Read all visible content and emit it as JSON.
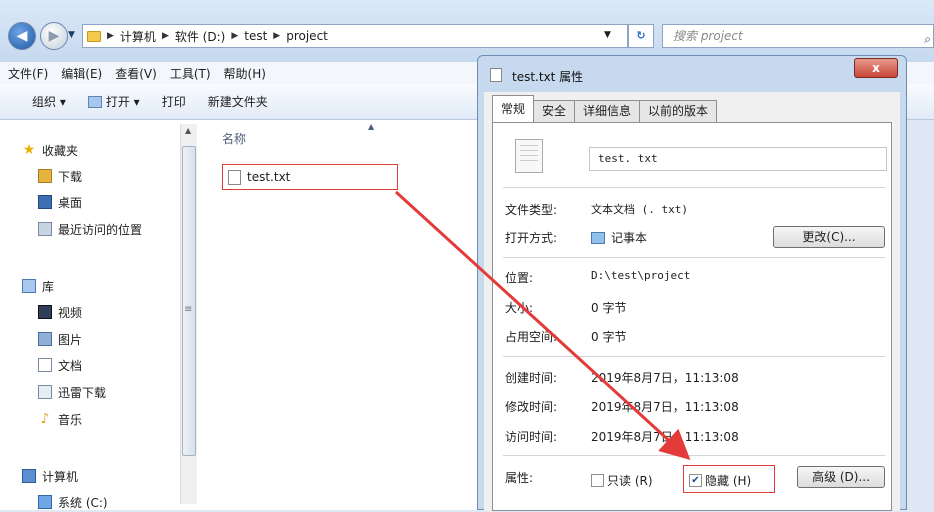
{
  "address_bar": {
    "breadcrumbs": [
      "计算机",
      "软件 (D:)",
      "test",
      "project"
    ],
    "search_placeholder": "搜索 project"
  },
  "menu": [
    "文件(F)",
    "编辑(E)",
    "查看(V)",
    "工具(T)",
    "帮助(H)"
  ],
  "toolbar": {
    "organize": "组织 ▾",
    "open": "打开 ▾",
    "print": "打印",
    "new_folder": "新建文件夹"
  },
  "sidebar": {
    "favorites": "收藏夹",
    "downloads": "下载",
    "desktop": "桌面",
    "recent": "最近访问的位置",
    "libraries": "库",
    "videos": "视频",
    "pictures": "图片",
    "documents": "文档",
    "thunder": "迅雷下载",
    "music": "音乐",
    "computer": "计算机",
    "system_drive": "系统 (C:)"
  },
  "file_list": {
    "column_name": "名称",
    "files": [
      "test.txt"
    ]
  },
  "dialog": {
    "title": "test.txt 属性",
    "close_label": "x",
    "tabs": [
      "常规",
      "安全",
      "详细信息",
      "以前的版本"
    ],
    "file_name": "test. txt",
    "type_label": "文件类型:",
    "type_value": "文本文档 (. txt)",
    "opens_with_label": "打开方式:",
    "opens_with_value": "记事本",
    "change_button": "更改(C)...",
    "location_label": "位置:",
    "location_value": "D:\\test\\project",
    "size_label": "大小:",
    "size_value": "0 字节",
    "size_on_disk_label": "占用空间:",
    "size_on_disk_value": "0 字节",
    "created_label": "创建时间:",
    "created_value": "2019年8月7日，11:13:08",
    "modified_label": "修改时间:",
    "modified_value": "2019年8月7日，11:13:08",
    "accessed_label": "访问时间:",
    "accessed_value": "2019年8月7日，11:13:08",
    "attributes_label": "属性:",
    "readonly_label": "只读 (R)",
    "readonly_checked": false,
    "hidden_label": "隐藏 (H)",
    "hidden_checked": true,
    "advanced_button": "高级 (D)..."
  },
  "colors": {
    "highlight_red": "#e33a3a",
    "titlebar_blue": "#c7d9ee",
    "close_red": "#c8473a"
  }
}
